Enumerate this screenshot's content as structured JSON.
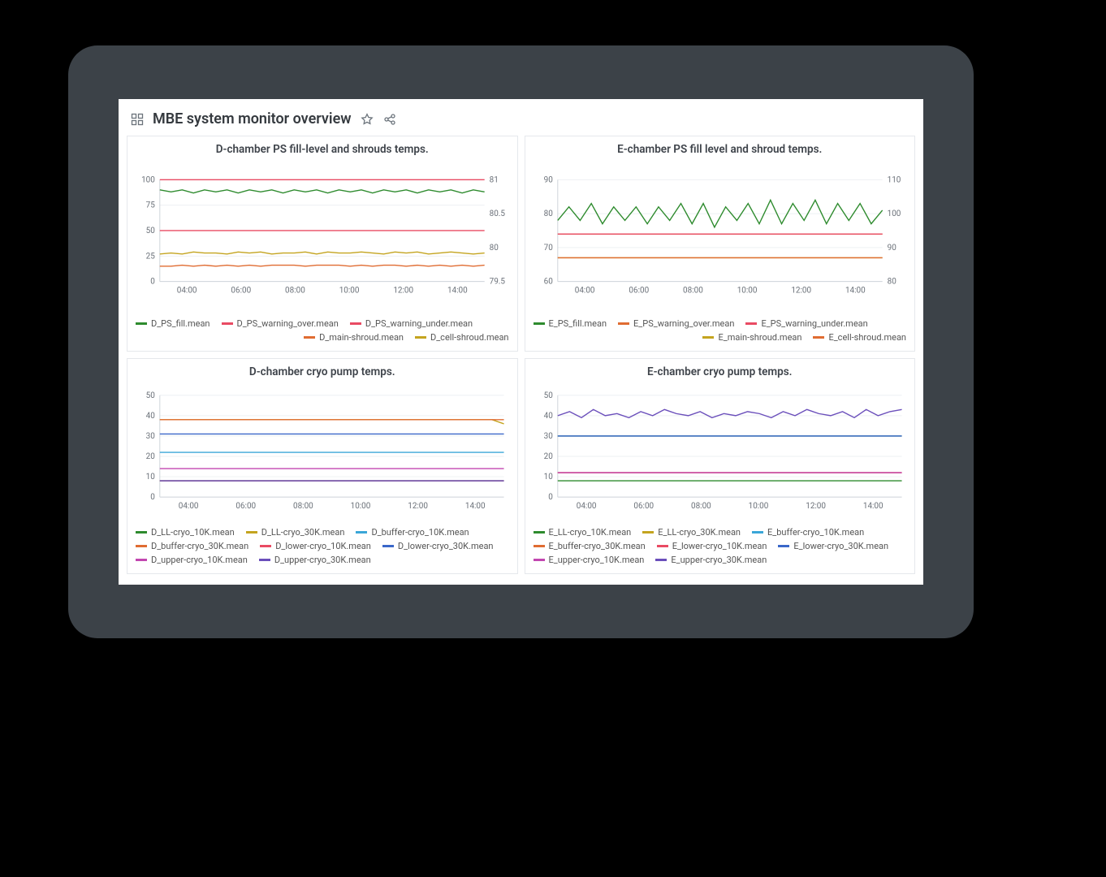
{
  "header": {
    "title": "MBE system monitor overview"
  },
  "x_ticks": [
    "04:00",
    "06:00",
    "08:00",
    "10:00",
    "12:00",
    "14:00"
  ],
  "chart_data": [
    {
      "id": "d_ps",
      "type": "line",
      "title": "D-chamber PS fill-level and shrouds temps.",
      "xlabel": "",
      "ylabel": "",
      "y_left": {
        "min": 0,
        "max": 100,
        "ticks": [
          0,
          25,
          50,
          75,
          100
        ]
      },
      "y_right": {
        "min": 79.5,
        "max": 81.0,
        "ticks": [
          79.5,
          80.0,
          80.5,
          81.0
        ]
      },
      "series": [
        {
          "name": "D_PS_fill.mean",
          "color": "#2e8b2e",
          "axis": "left",
          "values": [
            90,
            88,
            90,
            87,
            90,
            88,
            90,
            87,
            90,
            88,
            90,
            87,
            90,
            88,
            90,
            87,
            90,
            88,
            90,
            87,
            90,
            88,
            90,
            87,
            90,
            88,
            90,
            87,
            90,
            88
          ]
        },
        {
          "name": "D_PS_warning_over.mean",
          "color": "#e94b63",
          "axis": "left",
          "values": [
            100,
            100,
            100,
            100,
            100,
            100,
            100,
            100,
            100,
            100,
            100,
            100,
            100,
            100,
            100,
            100,
            100,
            100,
            100,
            100,
            100,
            100,
            100,
            100,
            100,
            100,
            100,
            100,
            100,
            100
          ]
        },
        {
          "name": "D_PS_warning_under.mean",
          "color": "#e94b63",
          "axis": "left",
          "values": [
            50,
            50,
            50,
            50,
            50,
            50,
            50,
            50,
            50,
            50,
            50,
            50,
            50,
            50,
            50,
            50,
            50,
            50,
            50,
            50,
            50,
            50,
            50,
            50,
            50,
            50,
            50,
            50,
            50,
            50
          ]
        },
        {
          "name": "D_main-shroud.mean",
          "color": "#e06c32",
          "axis": "left",
          "values": [
            15,
            15,
            16,
            15,
            16,
            15,
            16,
            15,
            16,
            15,
            16,
            16,
            16,
            15,
            16,
            16,
            16,
            15,
            16,
            15,
            16,
            16,
            15,
            16,
            15,
            16,
            15,
            16,
            15,
            16
          ]
        },
        {
          "name": "D_cell-shroud.mean",
          "color": "#c4a41f",
          "axis": "left",
          "values": [
            27,
            28,
            27,
            29,
            28,
            28,
            27,
            29,
            28,
            29,
            27,
            28,
            28,
            29,
            27,
            29,
            28,
            28,
            29,
            28,
            27,
            29,
            28,
            29,
            27,
            28,
            29,
            28,
            27,
            28
          ]
        }
      ],
      "legend_rows": [
        {
          "align": "left",
          "items": [
            "D_PS_fill.mean",
            "D_PS_warning_over.mean",
            "D_PS_warning_under.mean"
          ]
        },
        {
          "align": "right",
          "items": [
            "D_main-shroud.mean",
            "D_cell-shroud.mean"
          ]
        }
      ]
    },
    {
      "id": "e_ps",
      "type": "line",
      "title": "E-chamber PS fill level and shroud temps.",
      "xlabel": "",
      "ylabel": "",
      "y_left": {
        "min": 60,
        "max": 90,
        "ticks": [
          60,
          70,
          80,
          90
        ]
      },
      "y_right": {
        "min": 80,
        "max": 110,
        "ticks": [
          80,
          90,
          100,
          110
        ]
      },
      "series": [
        {
          "name": "E_PS_fill.mean",
          "color": "#2e8b2e",
          "axis": "left",
          "values": [
            78,
            82,
            78,
            83,
            77,
            82,
            78,
            82,
            77,
            82,
            78,
            83,
            77,
            83,
            76,
            82,
            78,
            83,
            77,
            84,
            77,
            83,
            78,
            84,
            77,
            83,
            78,
            83,
            77,
            81
          ]
        },
        {
          "name": "E_PS_warning_over.mean",
          "color": "#e06c32",
          "axis": "left",
          "values": [
            74,
            74,
            74,
            74,
            74,
            74,
            74,
            74,
            74,
            74,
            74,
            74,
            74,
            74,
            74,
            74,
            74,
            74,
            74,
            74,
            74,
            74,
            74,
            74,
            74,
            74,
            74,
            74,
            74,
            74
          ]
        },
        {
          "name": "E_PS_warning_under.mean",
          "color": "#e94b63",
          "axis": "left",
          "values": [
            74,
            74,
            74,
            74,
            74,
            74,
            74,
            74,
            74,
            74,
            74,
            74,
            74,
            74,
            74,
            74,
            74,
            74,
            74,
            74,
            74,
            74,
            74,
            74,
            74,
            74,
            74,
            74,
            74,
            74
          ]
        },
        {
          "name": "E_main-shroud.mean",
          "color": "#c4a41f",
          "axis": "left",
          "values": [
            67,
            67,
            67,
            67,
            67,
            67,
            67,
            67,
            67,
            67,
            67,
            67,
            67,
            67,
            67,
            67,
            67,
            67,
            67,
            67,
            67,
            67,
            67,
            67,
            67,
            67,
            67,
            67,
            67,
            67
          ]
        },
        {
          "name": "E_cell-shroud.mean",
          "color": "#e06c32",
          "axis": "left",
          "values": [
            67,
            67,
            67,
            67,
            67,
            67,
            67,
            67,
            67,
            67,
            67,
            67,
            67,
            67,
            67,
            67,
            67,
            67,
            67,
            67,
            67,
            67,
            67,
            67,
            67,
            67,
            67,
            67,
            67,
            67
          ]
        }
      ],
      "legend_rows": [
        {
          "align": "left",
          "items": [
            "E_PS_fill.mean",
            "E_PS_warning_over.mean",
            "E_PS_warning_under.mean"
          ]
        },
        {
          "align": "right",
          "items": [
            "E_main-shroud.mean",
            "E_cell-shroud.mean"
          ]
        }
      ]
    },
    {
      "id": "d_cryo",
      "type": "line",
      "title": "D-chamber cryo pump temps.",
      "xlabel": "",
      "ylabel": "",
      "y_left": {
        "min": 0,
        "max": 50,
        "ticks": [
          0,
          10,
          20,
          30,
          40,
          50
        ]
      },
      "series": [
        {
          "name": "D_LL-cryo_10K.mean",
          "color": "#2e8b2e",
          "values": [
            8,
            8,
            8,
            8,
            8,
            8,
            8,
            8,
            8,
            8,
            8,
            8,
            8,
            8,
            8,
            8,
            8,
            8,
            8,
            8,
            8,
            8,
            8,
            8,
            8,
            8,
            8,
            8,
            8,
            8
          ]
        },
        {
          "name": "D_LL-cryo_30K.mean",
          "color": "#c4a41f",
          "values": [
            38,
            38,
            38,
            38,
            38,
            38,
            38,
            38,
            38,
            38,
            38,
            38,
            38,
            38,
            38,
            38,
            38,
            38,
            38,
            38,
            38,
            38,
            38,
            38,
            38,
            38,
            38,
            38,
            38,
            36
          ]
        },
        {
          "name": "D_buffer-cryo_10K.mean",
          "color": "#3aa6d8",
          "values": [
            22,
            22,
            22,
            22,
            22,
            22,
            22,
            22,
            22,
            22,
            22,
            22,
            22,
            22,
            22,
            22,
            22,
            22,
            22,
            22,
            22,
            22,
            22,
            22,
            22,
            22,
            22,
            22,
            22,
            22
          ]
        },
        {
          "name": "D_buffer-cryo_30K.mean",
          "color": "#e06c32",
          "values": [
            38,
            38,
            38,
            38,
            38,
            38,
            38,
            38,
            38,
            38,
            38,
            38,
            38,
            38,
            38,
            38,
            38,
            38,
            38,
            38,
            38,
            38,
            38,
            38,
            38,
            38,
            38,
            38,
            38,
            38
          ]
        },
        {
          "name": "D_lower-cryo_10K.mean",
          "color": "#e94b63",
          "values": [
            8,
            8,
            8,
            8,
            8,
            8,
            8,
            8,
            8,
            8,
            8,
            8,
            8,
            8,
            8,
            8,
            8,
            8,
            8,
            8,
            8,
            8,
            8,
            8,
            8,
            8,
            8,
            8,
            8,
            8
          ]
        },
        {
          "name": "D_lower-cryo_30K.mean",
          "color": "#3a67c9",
          "values": [
            31,
            31,
            31,
            31,
            31,
            31,
            31,
            31,
            31,
            31,
            31,
            31,
            31,
            31,
            31,
            31,
            31,
            31,
            31,
            31,
            31,
            31,
            31,
            31,
            31,
            31,
            31,
            31,
            31,
            31
          ]
        },
        {
          "name": "D_upper-cryo_10K.mean",
          "color": "#c246b0",
          "values": [
            14,
            14,
            14,
            14,
            14,
            14,
            14,
            14,
            14,
            14,
            14,
            14,
            14,
            14,
            14,
            14,
            14,
            14,
            14,
            14,
            14,
            14,
            14,
            14,
            14,
            14,
            14,
            14,
            14,
            14
          ]
        },
        {
          "name": "D_upper-cryo_30K.mean",
          "color": "#6b4fbb",
          "values": [
            8,
            8,
            8,
            8,
            8,
            8,
            8,
            8,
            8,
            8,
            8,
            8,
            8,
            8,
            8,
            8,
            8,
            8,
            8,
            8,
            8,
            8,
            8,
            8,
            8,
            8,
            8,
            8,
            8,
            8
          ]
        }
      ],
      "legend_rows": [
        {
          "align": "left",
          "items": [
            "D_LL-cryo_10K.mean",
            "D_LL-cryo_30K.mean",
            "D_buffer-cryo_10K.mean"
          ]
        },
        {
          "align": "left",
          "items": [
            "D_buffer-cryo_30K.mean",
            "D_lower-cryo_10K.mean",
            "D_lower-cryo_30K.mean"
          ]
        },
        {
          "align": "left",
          "items": [
            "D_upper-cryo_10K.mean",
            "D_upper-cryo_30K.mean"
          ]
        }
      ]
    },
    {
      "id": "e_cryo",
      "type": "line",
      "title": "E-chamber cryo pump temps.",
      "xlabel": "",
      "ylabel": "",
      "y_left": {
        "min": 0,
        "max": 50,
        "ticks": [
          0,
          10,
          20,
          30,
          40,
          50
        ]
      },
      "series": [
        {
          "name": "E_LL-cryo_10K.mean",
          "color": "#2e8b2e",
          "values": [
            8,
            8,
            8,
            8,
            8,
            8,
            8,
            8,
            8,
            8,
            8,
            8,
            8,
            8,
            8,
            8,
            8,
            8,
            8,
            8,
            8,
            8,
            8,
            8,
            8,
            8,
            8,
            8,
            8,
            8
          ]
        },
        {
          "name": "E_LL-cryo_30K.mean",
          "color": "#c4a41f",
          "values": [
            30,
            30,
            30,
            30,
            30,
            30,
            30,
            30,
            30,
            30,
            30,
            30,
            30,
            30,
            30,
            30,
            30,
            30,
            30,
            30,
            30,
            30,
            30,
            30,
            30,
            30,
            30,
            30,
            30,
            30
          ]
        },
        {
          "name": "E_buffer-cryo_10K.mean",
          "color": "#3aa6d8",
          "values": [
            30,
            30,
            30,
            30,
            30,
            30,
            30,
            30,
            30,
            30,
            30,
            30,
            30,
            30,
            30,
            30,
            30,
            30,
            30,
            30,
            30,
            30,
            30,
            30,
            30,
            30,
            30,
            30,
            30,
            30
          ]
        },
        {
          "name": "E_buffer-cryo_30K.mean",
          "color": "#e06c32",
          "values": [
            12,
            12,
            12,
            12,
            12,
            12,
            12,
            12,
            12,
            12,
            12,
            12,
            12,
            12,
            12,
            12,
            12,
            12,
            12,
            12,
            12,
            12,
            12,
            12,
            12,
            12,
            12,
            12,
            12,
            12
          ]
        },
        {
          "name": "E_lower-cryo_10K.mean",
          "color": "#e94b63",
          "values": [
            12,
            12,
            12,
            12,
            12,
            12,
            12,
            12,
            12,
            12,
            12,
            12,
            12,
            12,
            12,
            12,
            12,
            12,
            12,
            12,
            12,
            12,
            12,
            12,
            12,
            12,
            12,
            12,
            12,
            12
          ]
        },
        {
          "name": "E_lower-cryo_30K.mean",
          "color": "#3a67c9",
          "values": [
            30,
            30,
            30,
            30,
            30,
            30,
            30,
            30,
            30,
            30,
            30,
            30,
            30,
            30,
            30,
            30,
            30,
            30,
            30,
            30,
            30,
            30,
            30,
            30,
            30,
            30,
            30,
            30,
            30,
            30
          ]
        },
        {
          "name": "E_upper-cryo_10K.mean",
          "color": "#c246b0",
          "values": [
            12,
            12,
            12,
            12,
            12,
            12,
            12,
            12,
            12,
            12,
            12,
            12,
            12,
            12,
            12,
            12,
            12,
            12,
            12,
            12,
            12,
            12,
            12,
            12,
            12,
            12,
            12,
            12,
            12,
            12
          ]
        },
        {
          "name": "E_upper-cryo_30K.mean",
          "color": "#6b4fbb",
          "values": [
            40,
            42,
            39,
            43,
            40,
            41,
            39,
            42,
            40,
            43,
            41,
            40,
            42,
            39,
            41,
            40,
            42,
            41,
            39,
            42,
            40,
            43,
            41,
            40,
            42,
            39,
            43,
            40,
            42,
            43
          ]
        }
      ],
      "legend_rows": [
        {
          "align": "left",
          "items": [
            "E_LL-cryo_10K.mean",
            "E_LL-cryo_30K.mean",
            "E_buffer-cryo_10K.mean"
          ]
        },
        {
          "align": "left",
          "items": [
            "E_buffer-cryo_30K.mean",
            "E_lower-cryo_10K.mean",
            "E_lower-cryo_30K.mean"
          ]
        },
        {
          "align": "left",
          "items": [
            "E_upper-cryo_10K.mean",
            "E_upper-cryo_30K.mean"
          ]
        }
      ]
    }
  ]
}
